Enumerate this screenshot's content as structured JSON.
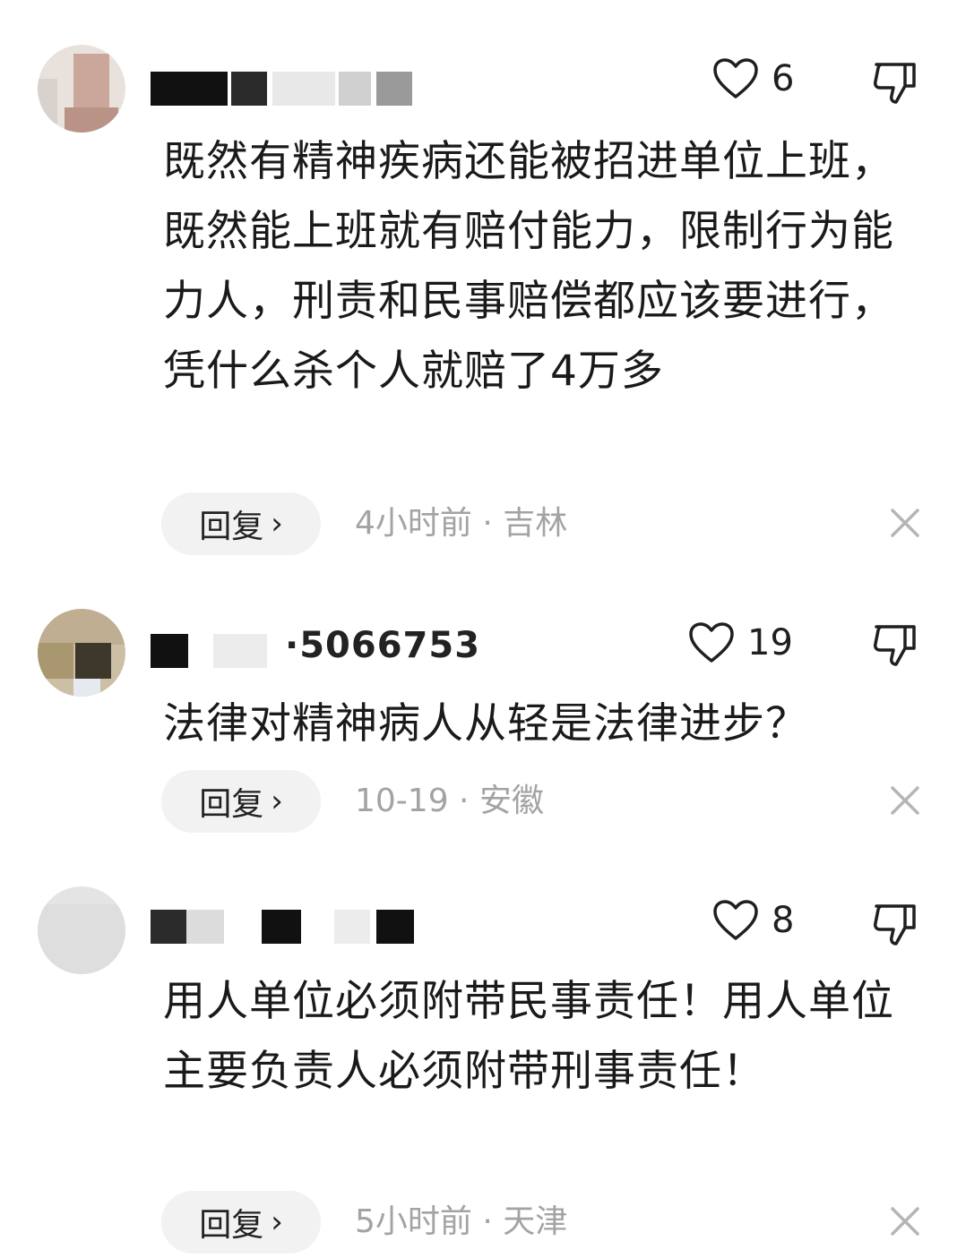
{
  "comments": [
    {
      "username_visible": "",
      "likes": "6",
      "text": "既然有精神疾病还能被招进单位上班，既然能上班就有赔付能力，限制行为能力人，刑责和民事赔偿都应该要进行，凭什么杀个人就赔了4万多",
      "reply_label": "回复",
      "meta": "4小时前 · 吉林"
    },
    {
      "username_visible": "·5066753",
      "likes": "19",
      "text": "法律对精神病人从轻是法律进步？",
      "reply_label": "回复",
      "meta": "10-19 · 安徽"
    },
    {
      "username_visible": "",
      "likes": "8",
      "text": "用人单位必须附带民事责任！用人单位主要负责人必须附带刑事责任！",
      "reply_label": "回复",
      "meta": "5小时前 · 天津"
    }
  ],
  "icons": {
    "like": "heart-outline-icon",
    "dislike": "thumbs-down-outline-icon",
    "close": "close-x-icon",
    "chevron": "chevron-right-icon"
  },
  "colors": {
    "text": "#1a1a1a",
    "meta": "#a3a3a3",
    "reply_bg": "#f2f2f2"
  }
}
